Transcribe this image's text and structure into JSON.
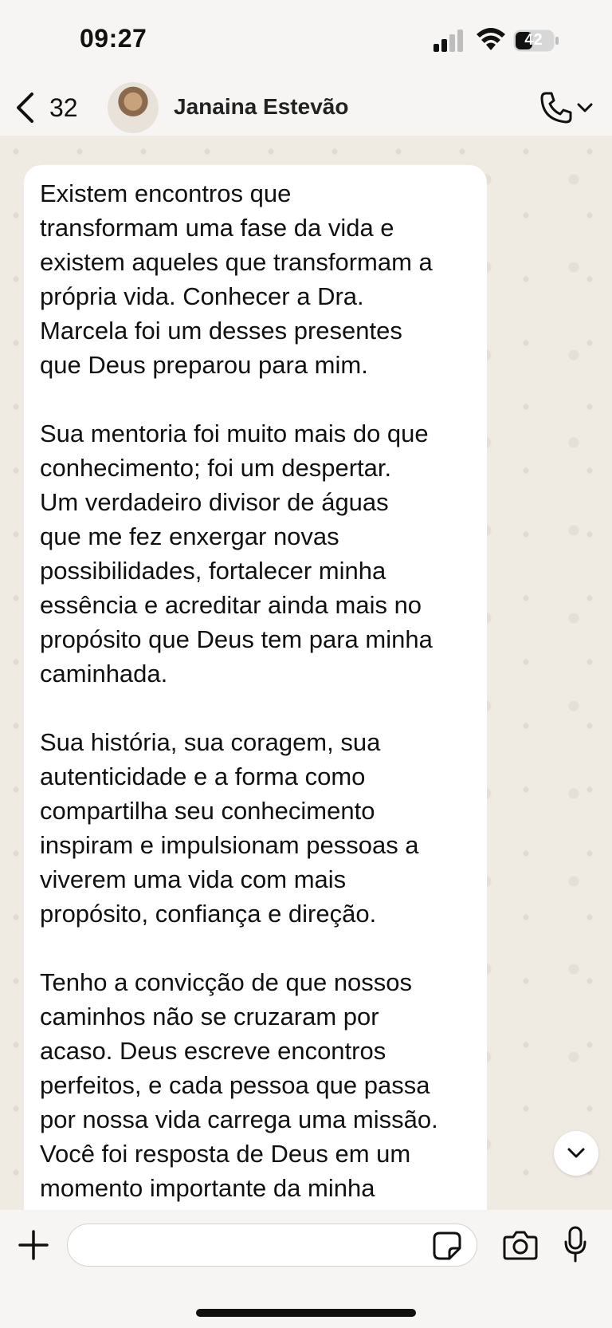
{
  "status_bar": {
    "time": "09:27",
    "battery_level": "42",
    "icons": [
      "signal-icon",
      "wifi-icon",
      "battery-icon"
    ]
  },
  "header": {
    "back_count": "32",
    "contact_name": "Janaina Estevão",
    "icons": [
      "chevron-left-icon",
      "phone-icon",
      "chevron-down-icon"
    ]
  },
  "message": {
    "text": "Existem encontros que\ntransformam uma fase da vida e\nexistem aqueles que transformam a\nprópria vida. Conhecer a Dra.\nMarcela foi um desses presentes\nque Deus preparou para mim.\n\nSua mentoria foi muito mais do que\nconhecimento; foi um despertar.\nUm verdadeiro divisor de águas\nque me fez enxergar novas\npossibilidades, fortalecer minha\nessência e acreditar ainda mais no\npropósito que Deus tem para minha\ncaminhada.\n\nSua história, sua coragem, sua\nautenticidade e a forma como\ncompartilha seu conhecimento\ninspiram e impulsionam pessoas a\nviverem uma vida com mais\npropósito, confiança e direção.\n\nTenho a convicção de que nossos\ncaminhos não se cruzaram por\nacaso. Deus escreve encontros\nperfeitos, e cada pessoa que passa\npor nossa vida carrega uma missão.\nVocê foi resposta de Deus em um\nmomento importante da minha"
  },
  "input_bar": {
    "placeholder": "",
    "value": "",
    "icons": [
      "plus-icon",
      "sticker-icon",
      "camera-icon",
      "microphone-icon"
    ]
  },
  "colors": {
    "chat_background": "#efeae2",
    "bubble": "#ffffff",
    "bars": "#f6f5f3"
  }
}
